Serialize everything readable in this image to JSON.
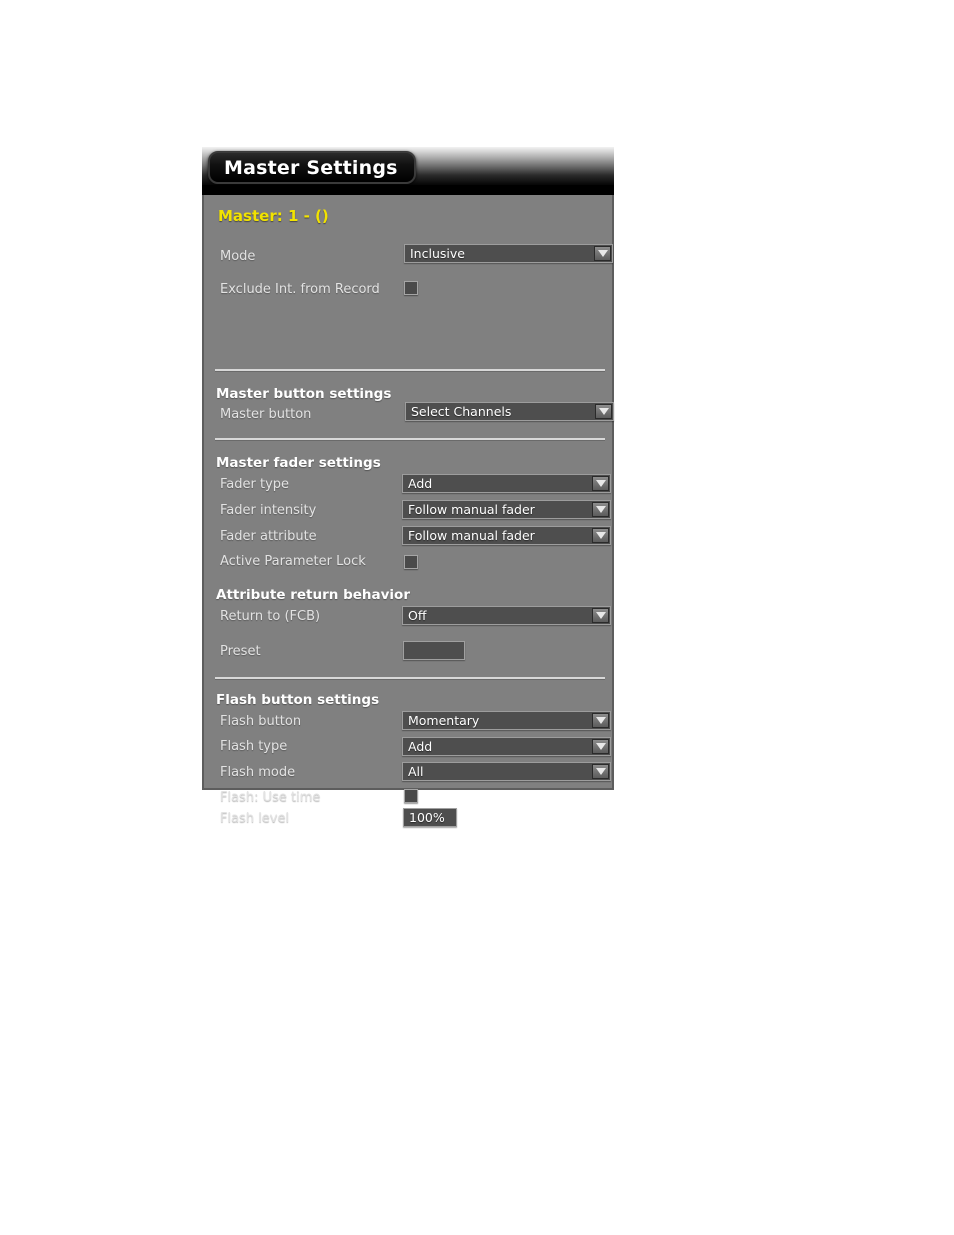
{
  "window": {
    "title": "Master Settings"
  },
  "panel": {
    "master_title": "Master: 1 - ()",
    "accent_color": "#f2e300",
    "background_color": "#808080",
    "control_color": "#4e4e4e"
  },
  "sections": [
    {
      "heading": "",
      "rows": [
        {
          "label": "Mode",
          "control": "dropdown",
          "value": "Inclusive"
        },
        {
          "label": "Exclude Int. from Record",
          "control": "checkbox",
          "checked": false
        }
      ]
    },
    {
      "heading": "Master button settings",
      "rows": [
        {
          "label": "Master button",
          "control": "dropdown",
          "value": "Select Channels"
        }
      ]
    },
    {
      "heading": "Master fader settings",
      "rows": [
        {
          "label": "Fader type",
          "control": "dropdown",
          "value": "Add"
        },
        {
          "label": "Fader intensity",
          "control": "dropdown",
          "value": "Follow manual fader"
        },
        {
          "label": "Fader attribute",
          "control": "dropdown",
          "value": "Follow manual fader"
        },
        {
          "label": "Active Parameter Lock",
          "control": "checkbox",
          "checked": false
        }
      ]
    },
    {
      "heading": "Attribute return behavior",
      "rows": [
        {
          "label": "Return to (FCB)",
          "control": "dropdown",
          "value": "Off"
        },
        {
          "label": "Preset",
          "control": "textfield",
          "value": ""
        }
      ]
    },
    {
      "heading": "Flash button settings",
      "rows": [
        {
          "label": "Flash button",
          "control": "dropdown",
          "value": "Momentary"
        },
        {
          "label": "Flash type",
          "control": "dropdown",
          "value": "Add"
        },
        {
          "label": "Flash mode",
          "control": "dropdown",
          "value": "All"
        },
        {
          "label": "Flash: Use time",
          "control": "checkbox",
          "checked": false
        },
        {
          "label": "Flash level",
          "control": "textfield",
          "value": "100%"
        }
      ]
    }
  ],
  "icons": {
    "dropdown_arrow": "chevron-down-icon"
  }
}
